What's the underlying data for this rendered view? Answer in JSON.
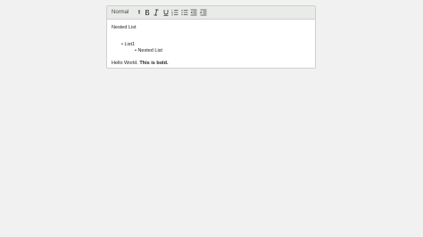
{
  "toolbar": {
    "format_value": "Normal",
    "buttons": [
      {
        "name": "bold-button",
        "icon": "bold-icon"
      },
      {
        "name": "italic-button",
        "icon": "italic-icon"
      },
      {
        "name": "underline-button",
        "icon": "underline-icon"
      },
      {
        "name": "ordered-list-button",
        "icon": "ordered-list-icon"
      },
      {
        "name": "bullet-list-button",
        "icon": "bullet-list-icon"
      },
      {
        "name": "outdent-button",
        "icon": "outdent-icon"
      },
      {
        "name": "indent-button",
        "icon": "indent-icon"
      }
    ]
  },
  "content": {
    "heading": "Nested List",
    "list_item_1": "List1",
    "nested_item": "Nested List",
    "hello_text": "Hello World. ",
    "bold_text": "This is bold."
  },
  "colors": {
    "page_bg": "#f2f1f1",
    "toolbar_bg": "#e8ebe8",
    "border": "#cfcfcf",
    "icon": "#444444"
  }
}
